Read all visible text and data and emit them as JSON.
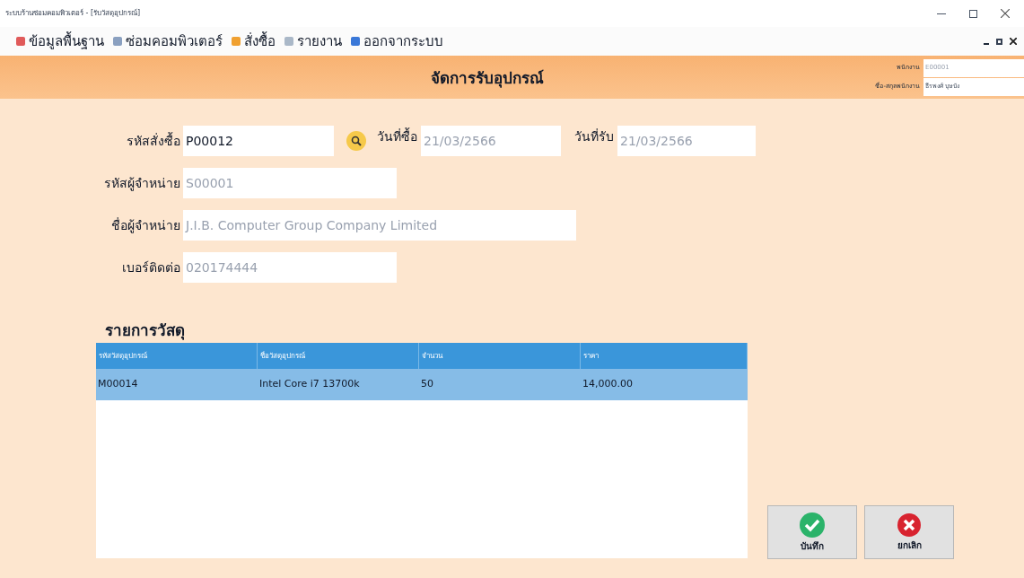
{
  "window": {
    "title": "ระบบร้านซ่อมคอมพิวเตอร์ - [รับวัสดุอุปกรณ์]"
  },
  "menu": [
    "ข้อมูลพื้นฐาน",
    "ซ่อมคอมพิวเตอร์",
    "สั่งซื้อ",
    "รายงาน",
    "ออกจากระบบ"
  ],
  "header": {
    "title": "จัดการรับอุปกรณ์",
    "employee_label": "พนักงาน",
    "employee_id": "E00001",
    "employee_name_label": "ชื่อ-สกุลพนักงาน",
    "employee_name": "ธีรพงศ์ บุษบัง"
  },
  "form": {
    "order_id_label": "รหัสสั่งซื้อ",
    "order_id": "P00012",
    "purchase_date_label": "วันที่ซื้อ",
    "purchase_date": "21/03/2566",
    "receive_date_label": "วันที่รับ",
    "receive_date": "21/03/2566",
    "supplier_id_label": "รหัสผู้จำหน่าย",
    "supplier_id": "S00001",
    "supplier_name_label": "ชื่อผู้จำหน่าย",
    "supplier_name": "J.I.B. Computer Group Company Limited",
    "phone_label": "เบอร์ติดต่อ",
    "phone": "020174444"
  },
  "table": {
    "title": "รายการวัสดุ",
    "columns": [
      "รหัสวัสดุอุปกรณ์",
      "ชื่อวัสดุอุปกรณ์",
      "จำนวน",
      "ราคา"
    ],
    "rows": [
      {
        "cells": [
          "M00014",
          "Intel Core i7 13700k",
          "50",
          "14,000.00"
        ],
        "selected": true
      }
    ]
  },
  "buttons": [
    {
      "kind": "save",
      "label": "บันทึก"
    },
    {
      "kind": "cancel",
      "label": "ยกเลิก"
    }
  ]
}
